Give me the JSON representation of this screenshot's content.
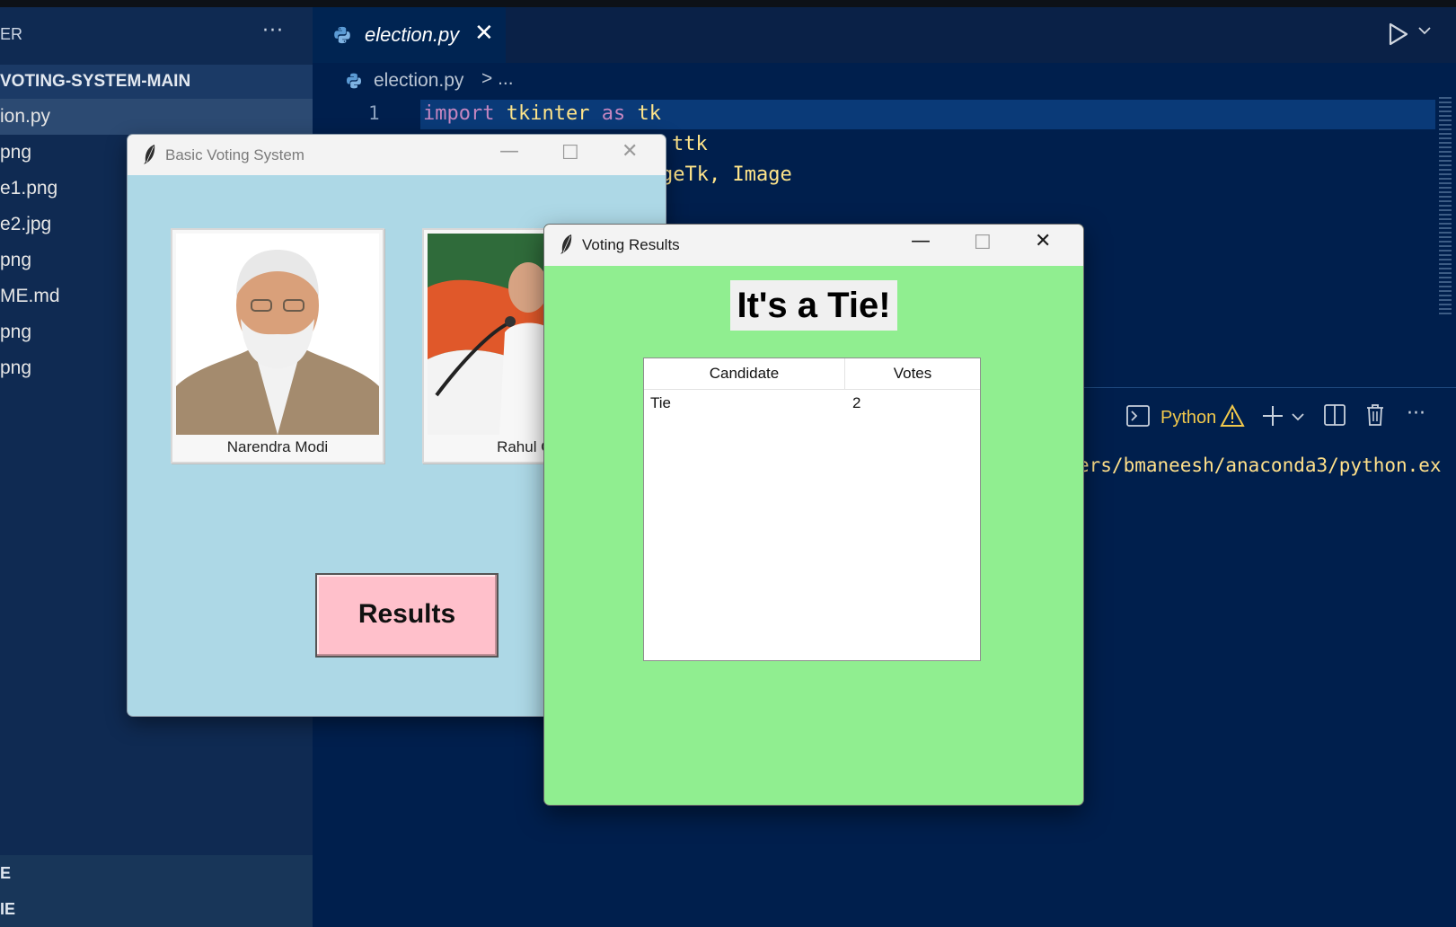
{
  "sidebar": {
    "title": "ER",
    "more": "···",
    "project": "VOTING-SYSTEM-MAIN",
    "files": [
      "ion.py",
      "png",
      "e1.png",
      "e2.jpg",
      "png",
      "ME.md",
      "png",
      "png"
    ],
    "bottom_sections": [
      "E",
      "IE"
    ]
  },
  "editor": {
    "tab": {
      "label": "election.py",
      "close": "✕"
    },
    "breadcrumb": {
      "file": "election.py",
      "sep": "> ..."
    },
    "lines": {
      "n1": "1",
      "l1_kw1": "import",
      "l1_mod": "tkinter",
      "l1_kw2": "as",
      "l1_alias": "tk",
      "l2_tail": "ttk",
      "l3_tail": "geTk, Image"
    }
  },
  "terminal": {
    "shell": "Python",
    "path": "ers/bmaneesh/anaconda3/python.ex"
  },
  "win_main": {
    "title": "Basic Voting System",
    "candidates": [
      {
        "name": "Narendra Modi"
      },
      {
        "name": "Rahul Ga"
      }
    ],
    "results_button": "Results"
  },
  "win_results": {
    "title": "Voting Results",
    "heading": "It's a Tie!",
    "table": {
      "columns": [
        "Candidate",
        "Votes"
      ],
      "rows": [
        {
          "candidate": "Tie",
          "votes": "2"
        }
      ]
    }
  },
  "colors": {
    "vscode_bg": "#001f4d",
    "main_window_bg": "#add8e6",
    "results_window_bg": "#90ee90",
    "results_button_bg": "#ffc0cb",
    "terminal_text": "#ffe08a",
    "python_warning": "#f2c94c"
  },
  "icons": [
    "python-file-icon",
    "run-icon",
    "chevron-down-icon",
    "terminal-icon",
    "warning-icon",
    "plus-icon",
    "split-icon",
    "trash-icon",
    "more-icon",
    "feather-icon",
    "minimize-icon",
    "maximize-icon",
    "close-icon"
  ]
}
